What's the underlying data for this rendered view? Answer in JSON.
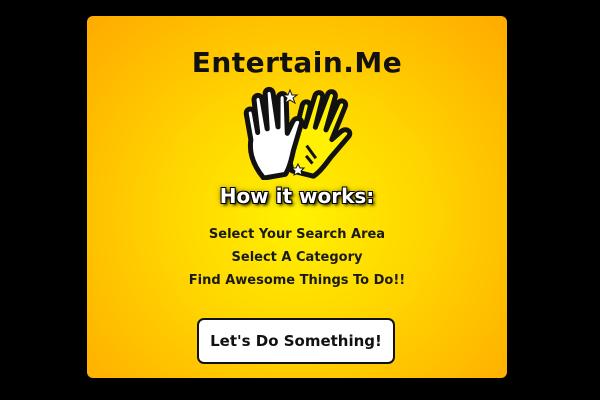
{
  "app": {
    "title": "Entertain.Me"
  },
  "logo": {
    "icon": "high-five-hands-icon",
    "colors": {
      "left_hand": "#ffffff",
      "right_hand": "#fff100",
      "outline": "#111111"
    }
  },
  "how_it_works": {
    "heading": "How it works:",
    "steps": [
      "Select Your Search Area",
      "Select A Category",
      "Find Awesome Things To Do!!"
    ]
  },
  "cta": {
    "label": "Let's Do Something!"
  },
  "colors": {
    "page_background": "#000000",
    "card_gradient_center": "#fff200",
    "card_gradient_edge": "#ffaa00",
    "text": "#111111"
  }
}
